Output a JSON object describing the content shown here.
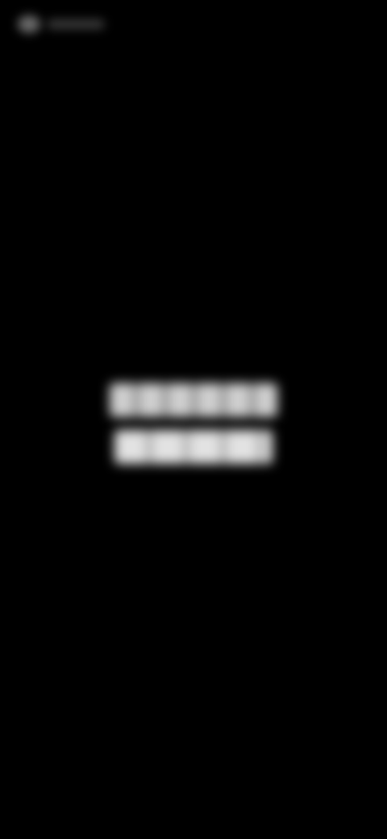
{
  "screen": {
    "background_color": "#000000",
    "status_indicator": {
      "icon": "blurred-status-icon"
    },
    "center_message": {
      "line_1": "",
      "line_2": ""
    }
  }
}
